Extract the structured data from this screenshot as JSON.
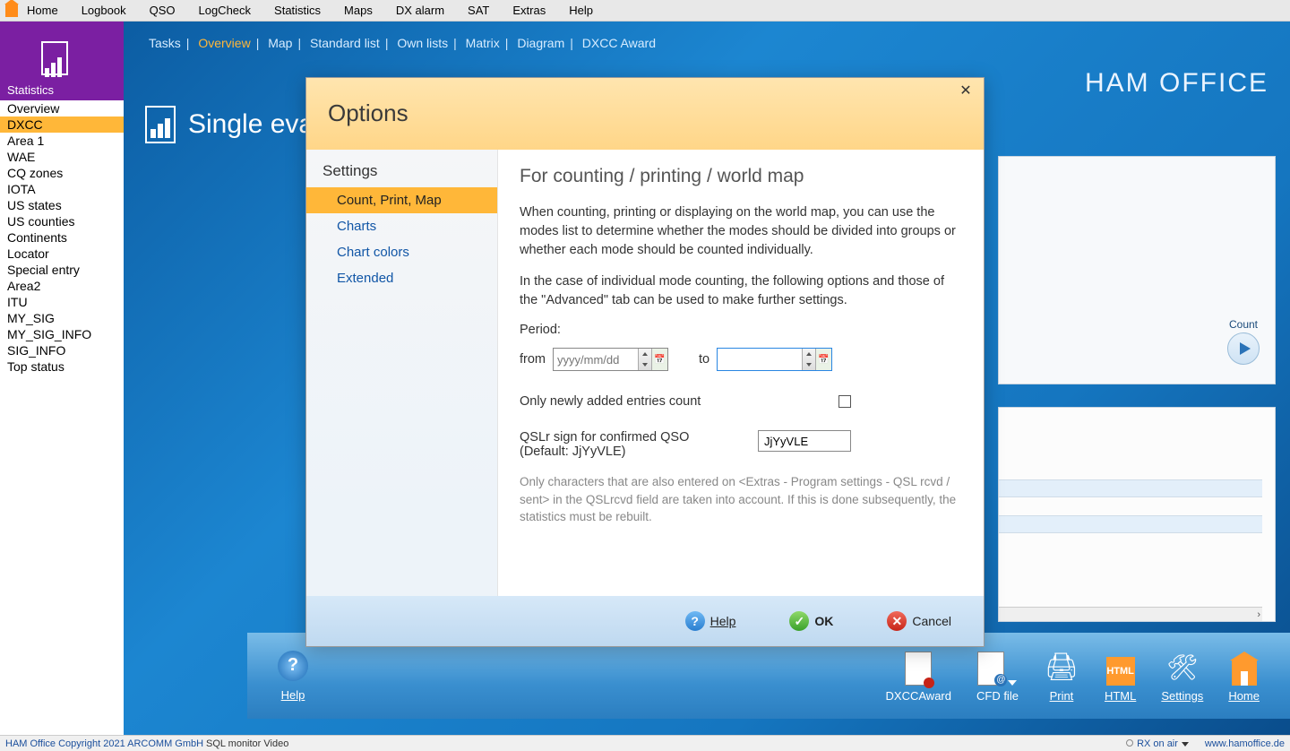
{
  "menu": [
    "Home",
    "Logbook",
    "QSO",
    "LogCheck",
    "Statistics",
    "Maps",
    "DX alarm",
    "SAT",
    "Extras",
    "Help"
  ],
  "sidebar": {
    "title": "Statistics",
    "items": [
      "Overview",
      "DXCC",
      "Area 1",
      "WAE",
      "CQ zones",
      "IOTA",
      "US states",
      "US counties",
      "Continents",
      "Locator",
      "Special entry",
      "Area2",
      "ITU",
      "MY_SIG",
      "MY_SIG_INFO",
      "SIG_INFO",
      "Top status"
    ],
    "selected": "DXCC"
  },
  "tabs": {
    "items": [
      "Tasks",
      "Overview",
      "Map",
      "Standard list",
      "Own lists",
      "Matrix",
      "Diagram",
      "DXCC Award"
    ],
    "active": "Overview"
  },
  "brand": "HAM OFFICE",
  "page_title": "Single eva",
  "count_label": "Count",
  "dialog": {
    "title": "Options",
    "nav_heading": "Settings",
    "nav_items": [
      "Count, Print, Map",
      "Charts",
      "Chart colors",
      "Extended"
    ],
    "nav_selected": "Count, Print, Map",
    "heading": "For counting / printing / world map",
    "p1": "When counting, printing or displaying on the world map, you can use the modes list to determine whether the modes should be divided into groups or whether each mode should be counted individually.",
    "p2": "In the case of individual mode counting, the following options and those of the \"Advanced\" tab can be used to make further settings.",
    "period_label": "Period:",
    "from_label": "from",
    "from_placeholder": "yyyy/mm/dd",
    "to_label": "to",
    "to_value": "",
    "only_new_label": "Only newly added entries count",
    "qslr_label_1": "QSLr sign for confirmed QSO",
    "qslr_label_2": "(Default: JjYyVLE)",
    "qslr_value": "JjYyVLE",
    "hint": "Only characters that are also entered on <Extras - Program settings - QSL rcvd / sent> in the QSLrcvd field are taken into account. If this is done subsequently, the statistics must be rebuilt.",
    "btn_help": "Help",
    "btn_ok": "OK",
    "btn_cancel": "Cancel"
  },
  "bottom": {
    "help": "Help",
    "items": [
      "DXCCAward",
      "CFD file",
      "Print",
      "HTML",
      "Settings",
      "Home"
    ]
  },
  "status": {
    "left": "HAM Office Copyright 2021 ARCOMM GmbH",
    "mid": "SQL monitor   Video",
    "rx": "RX on air",
    "url": "www.hamoffice.de"
  }
}
